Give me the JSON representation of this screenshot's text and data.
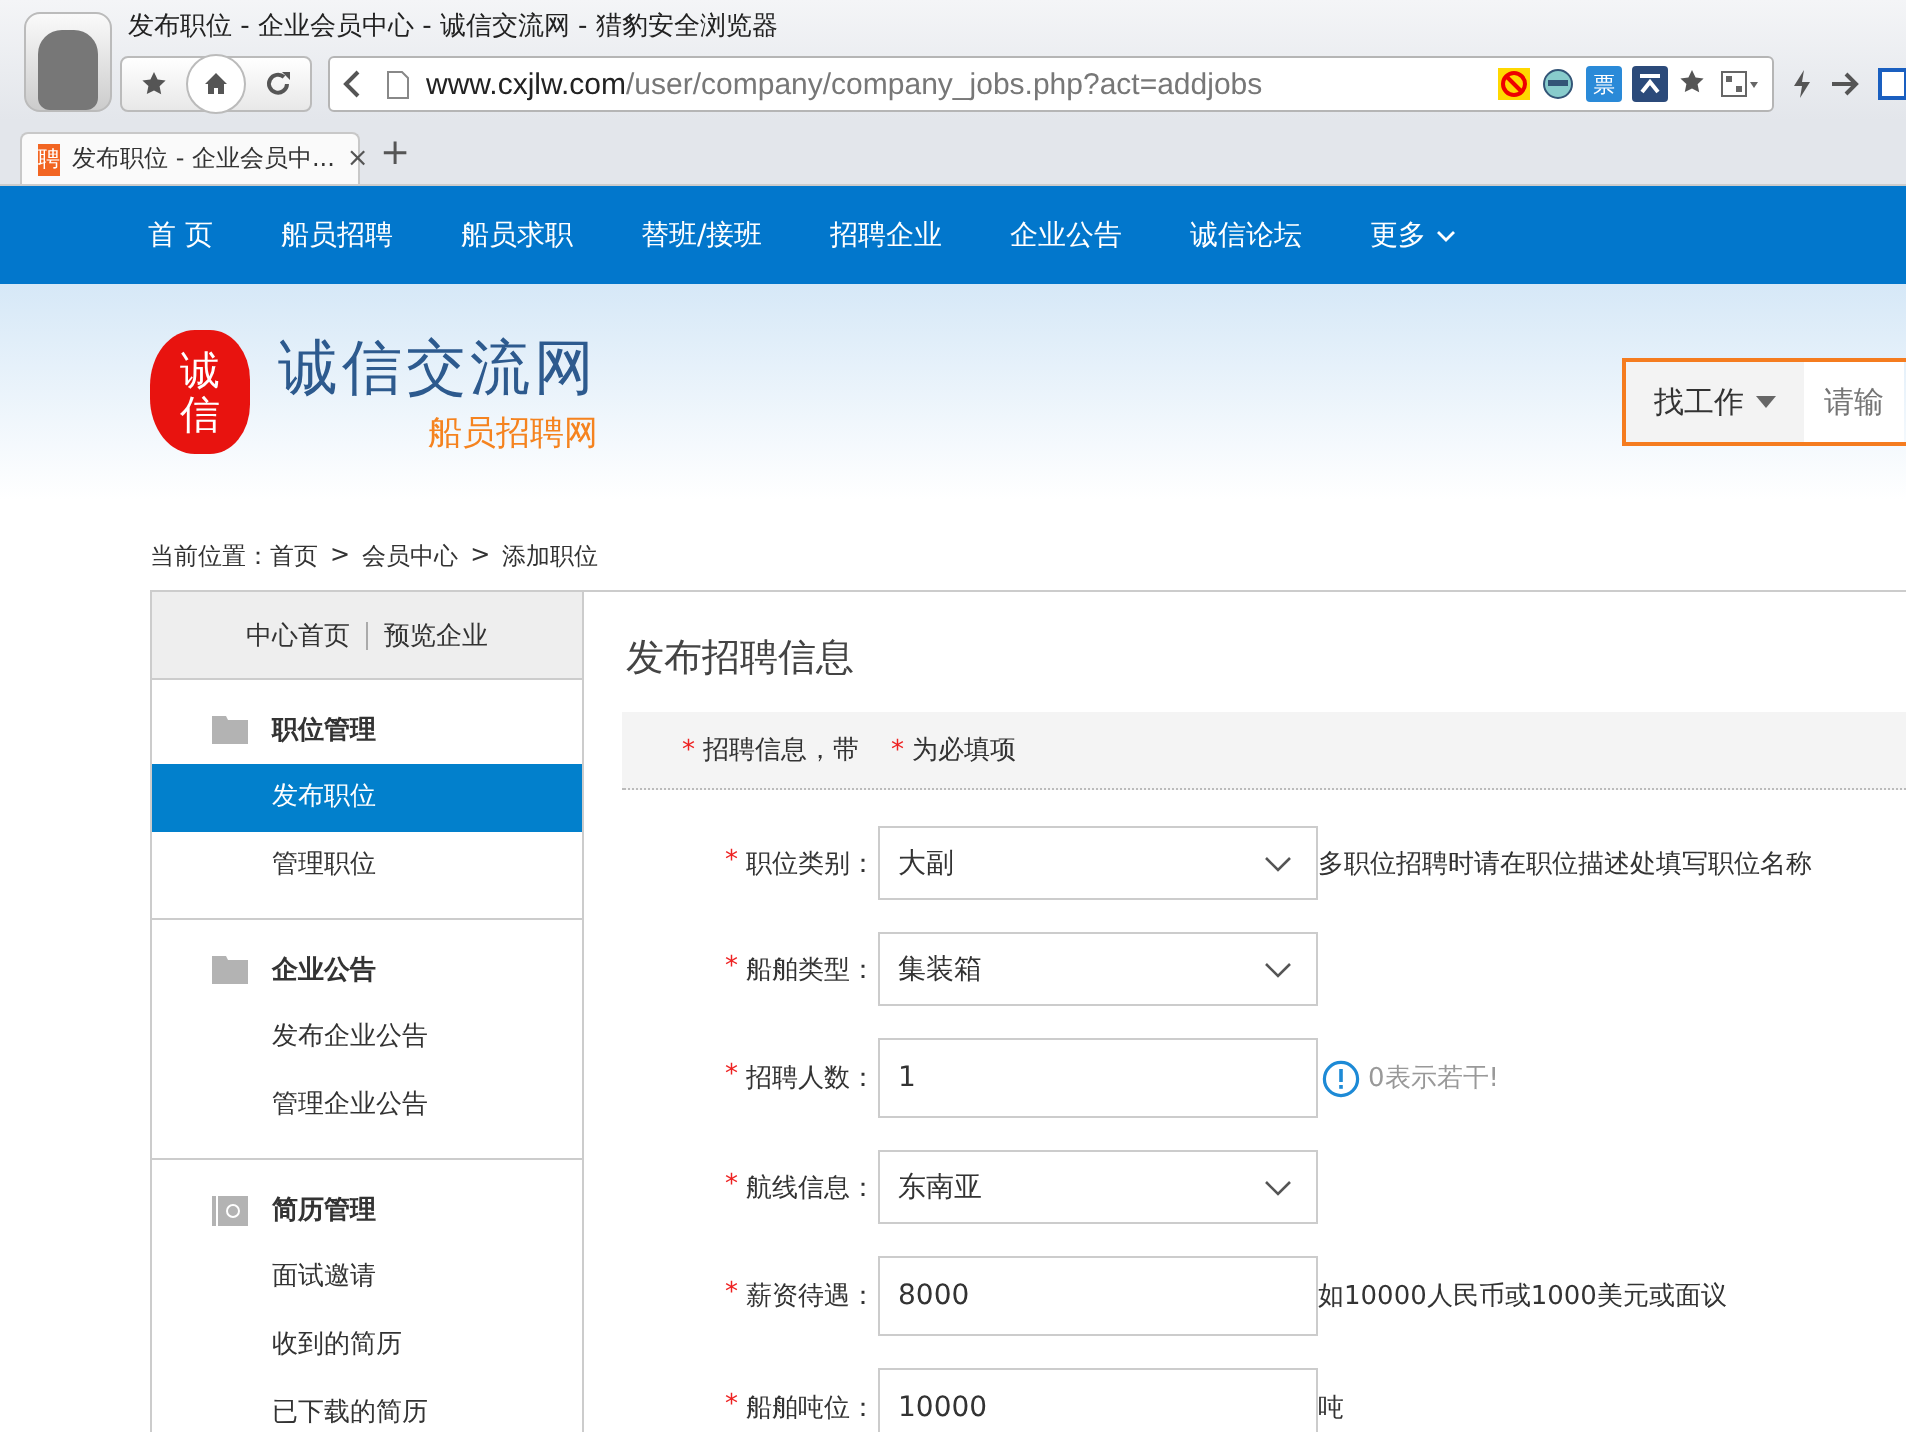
{
  "browser": {
    "title": "发布职位 - 企业会员中心 - 诚信交流网 - 猎豹安全浏览器",
    "url_host": "www.cxjlw.com",
    "url_path": "/user/company/company_jobs.php?act=addjobs",
    "badge_icon": "票",
    "tab": {
      "favicon": "聘",
      "label": "发布职位 - 企业会员中...",
      "close": "×"
    },
    "new_tab": "+"
  },
  "nav": [
    {
      "label": "首 页"
    },
    {
      "label": "船员招聘"
    },
    {
      "label": "船员求职"
    },
    {
      "label": "替班/接班"
    },
    {
      "label": "招聘企业"
    },
    {
      "label": "企业公告"
    },
    {
      "label": "诚信论坛"
    },
    {
      "label": "更多",
      "caret": true
    }
  ],
  "header": {
    "seal": [
      "诚",
      "信"
    ],
    "site_name": "诚信交流网",
    "slogan": "船员招聘网",
    "search": {
      "category": "找工作",
      "placeholder": "请输"
    }
  },
  "breadcrumb": {
    "items": [
      "当前位置：首页",
      "会员中心",
      "添加职位"
    ],
    "separators": [
      ">",
      ">"
    ]
  },
  "sidebar": {
    "top_links": [
      "中心首页",
      "预览企业"
    ],
    "groups": [
      {
        "title": "职位管理",
        "kind": "folder",
        "items": [
          {
            "label": "发布职位",
            "selected": true
          },
          {
            "label": "管理职位",
            "selected": false
          }
        ]
      },
      {
        "title": "企业公告",
        "kind": "folder",
        "items": [
          {
            "label": "发布企业公告",
            "selected": false
          },
          {
            "label": "管理企业公告",
            "selected": false
          }
        ]
      },
      {
        "title": "简历管理",
        "kind": "at",
        "items": [
          {
            "label": "面试邀请",
            "selected": false
          },
          {
            "label": "收到的简历",
            "selected": false
          },
          {
            "label": "已下载的简历",
            "selected": false
          }
        ]
      }
    ]
  },
  "content": {
    "title": "发布招聘信息",
    "notice": [
      {
        "mark": "*",
        "text": "招聘信息，带"
      },
      {
        "mark": "*",
        "text": "为必填项"
      }
    ],
    "fields": [
      {
        "mark": "*",
        "label": "职位类别：",
        "kind": "select",
        "value": "大副",
        "hint": "多职位招聘时请在职位描述处填写职位名称",
        "hint_icon": false
      },
      {
        "mark": "*",
        "label": "船舶类型：",
        "kind": "select",
        "value": "集装箱"
      },
      {
        "mark": "*",
        "label": "招聘人数：",
        "kind": "input",
        "value": "1",
        "hint": "0表示若干!",
        "hint_icon": true
      },
      {
        "mark": "*",
        "label": "航线信息：",
        "kind": "select",
        "value": "东南亚"
      },
      {
        "mark": "*",
        "label": "薪资待遇：",
        "kind": "input",
        "value": "8000",
        "hint": "如10000人民币或1000美元或面议",
        "hint_icon": false
      },
      {
        "mark": "*",
        "label": "船舶吨位：",
        "kind": "input",
        "value": "10000",
        "hint": "吨",
        "hint_icon": false
      }
    ]
  }
}
